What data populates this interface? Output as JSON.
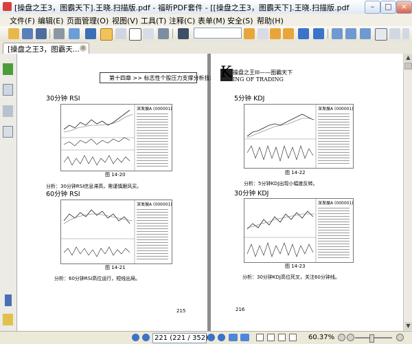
{
  "window": {
    "title": "[操盘之王3，图霸天下].王晓.扫描版.pdf - 福昕PDF套件 - [[操盘之王3，图霸天下].王晓.扫描版.pdf]",
    "minimize_glyph": "–",
    "maximize_glyph": "□",
    "close_glyph": "×"
  },
  "menu": [
    {
      "label": "文件(F)"
    },
    {
      "label": "编辑(E)"
    },
    {
      "label": "页面管理(O)"
    },
    {
      "label": "视图(V)"
    },
    {
      "label": "工具(T)"
    },
    {
      "label": "注释(C)"
    },
    {
      "label": "表单(M)"
    },
    {
      "label": "安全(S)"
    },
    {
      "label": "帮助(H)"
    }
  ],
  "tab": {
    "label": "[操盘之王3，图霸天...",
    "close_glyph": "×"
  },
  "pages": {
    "left": {
      "running_head": "第十四章 >> 标志性个股压力支撑分析技术",
      "top_section": {
        "title": "30分钟 RSI",
        "figure": "图 14-20",
        "analysis": "分析：30分钟RSI信息滞高，需谨慎跟风买。"
      },
      "bottom_section": {
        "title": "60分钟 RSI",
        "figure": "图 14-21",
        "analysis": "分析：60分钟RSI高位运行，短线出局。"
      },
      "page_number": "215"
    },
    "right": {
      "logo_letter": "K",
      "logo_text": "操盘之王III——图霸天下",
      "logo_subtitle": "ING OF TRADING",
      "top_section": {
        "title": "5分钟 KDJ",
        "figure": "图 14-22",
        "analysis": "分析：5分钟KDJ出现小幅度反转。"
      },
      "bottom_section": {
        "title": "30分钟 KDJ",
        "figure": "图 14-23",
        "analysis": "分析：30分钟KDJ高位死叉，关注60分钟线。"
      },
      "page_number": "216"
    }
  },
  "chart_header": {
    "stock": "深发展A",
    "code": "(000001)"
  },
  "status": {
    "page_input": "221 (221 / 352)",
    "zoom": "60.37%"
  },
  "colors": {
    "accent": "#316ac5",
    "viewport": "#8c8c8c"
  }
}
